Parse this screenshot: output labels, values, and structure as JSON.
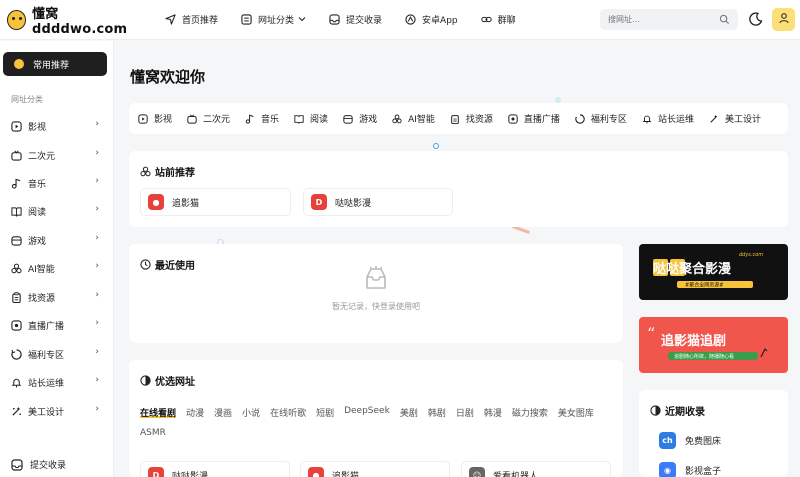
{
  "header": {
    "logo_text": "懂窝ddddwo.com",
    "nav": [
      {
        "label": "首页推荐",
        "icon": "send-icon"
      },
      {
        "label": "网址分类",
        "icon": "list-icon",
        "has_caret": true
      },
      {
        "label": "提交收录",
        "icon": "inbox-icon"
      },
      {
        "label": "安卓App",
        "icon": "android-icon"
      },
      {
        "label": "群聊",
        "icon": "link-icon"
      }
    ],
    "search_placeholder": "搜网址..."
  },
  "sidebar": {
    "active_label": "常用推荐",
    "group_label": "网址分类",
    "items": [
      {
        "label": "影视",
        "icon": "play-icon"
      },
      {
        "label": "二次元",
        "icon": "tv-icon"
      },
      {
        "label": "音乐",
        "icon": "music-icon"
      },
      {
        "label": "阅读",
        "icon": "book-icon"
      },
      {
        "label": "游戏",
        "icon": "game-icon"
      },
      {
        "label": "AI智能",
        "icon": "ai-icon"
      },
      {
        "label": "找资源",
        "icon": "clipboard-icon"
      },
      {
        "label": "直播广播",
        "icon": "radio-icon"
      },
      {
        "label": "福利专区",
        "icon": "gift-icon"
      },
      {
        "label": "站长运维",
        "icon": "bell-icon"
      },
      {
        "label": "美工设计",
        "icon": "brush-icon"
      }
    ],
    "submit_label": "提交收录"
  },
  "main": {
    "welcome": "懂窝欢迎你",
    "categories": [
      {
        "label": "影视",
        "icon": "play-icon"
      },
      {
        "label": "二次元",
        "icon": "tv-icon"
      },
      {
        "label": "音乐",
        "icon": "music-icon"
      },
      {
        "label": "阅读",
        "icon": "book-icon"
      },
      {
        "label": "游戏",
        "icon": "game-icon"
      },
      {
        "label": "AI智能",
        "icon": "ai-icon"
      },
      {
        "label": "找资源",
        "icon": "clipboard-icon"
      },
      {
        "label": "直播广播",
        "icon": "radio-icon"
      },
      {
        "label": "福利专区",
        "icon": "gift-icon"
      },
      {
        "label": "站长运维",
        "icon": "bell-icon"
      },
      {
        "label": "美工设计",
        "icon": "brush-icon"
      }
    ],
    "featured": {
      "title": "站前推荐",
      "sites": [
        {
          "label": "追影猫",
          "color": "#e8413c"
        },
        {
          "label": "哒哒影漫",
          "color": "#e8413c"
        }
      ]
    },
    "recent": {
      "title": "最近使用",
      "empty_text": "暂无记录，快登录使用吧"
    },
    "selected": {
      "title": "优选网址",
      "tabs": [
        "在线看剧",
        "动漫",
        "漫画",
        "小说",
        "在线听歌",
        "短剧",
        "DeepSeek",
        "美剧",
        "韩剧",
        "日剧",
        "韩漫",
        "磁力搜索",
        "美女图库",
        "ASMR"
      ],
      "active_tab": 0,
      "sites": [
        {
          "label": "哒哒影漫",
          "color": "#e8413c"
        },
        {
          "label": "追影猫",
          "color": "#e8413c"
        },
        {
          "label": "爱看机器人",
          "color": "#666666"
        }
      ]
    }
  },
  "banners": {
    "top": {
      "line1": "哒哒聚合影漫",
      "sub": "ddys.com",
      "tag": "#聚合全网资源#"
    },
    "bottom": {
      "line1": "追影猫追剧",
      "sub": "追剧随心所欲，随播随心看"
    }
  },
  "recent_collect": {
    "title": "近期收录",
    "items": [
      {
        "label": "免费图床",
        "icon_text": "ch",
        "color": "#2f7de1"
      },
      {
        "label": "影视盒子",
        "icon_text": "◉",
        "color": "#3b7bf6"
      }
    ]
  }
}
